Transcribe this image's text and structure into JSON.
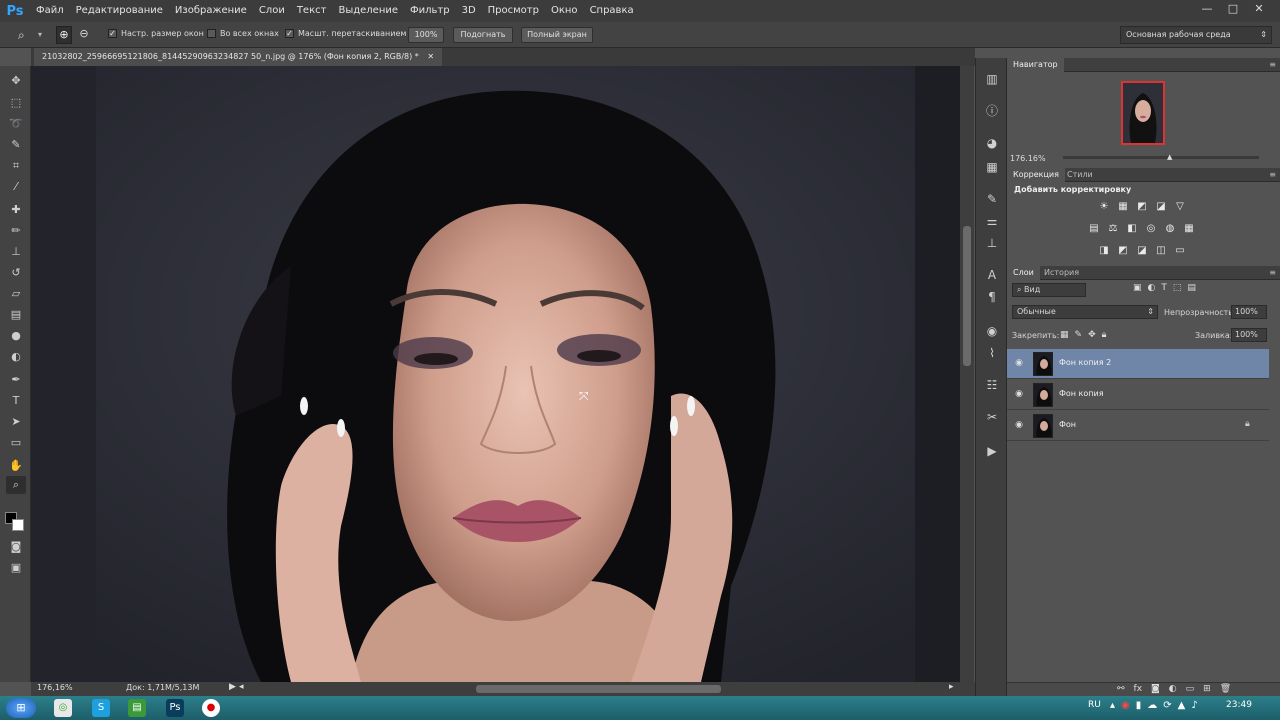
{
  "app": {
    "logo": "Ps"
  },
  "menu": [
    "Файл",
    "Редактирование",
    "Изображение",
    "Слои",
    "Текст",
    "Выделение",
    "Фильтр",
    "3D",
    "Просмотр",
    "Окно",
    "Справка"
  ],
  "window_controls": {
    "minimize": "—",
    "maximize": "□",
    "close": "✕"
  },
  "options": {
    "resize_windows": "Настр. размер окон",
    "all_windows": "Во всех окнах",
    "scrubby_zoom": "Масшт. перетаскиванием",
    "zoom_100": "100%",
    "fit_screen": "Подогнать",
    "full_screen": "Полный экран",
    "workspace": "Основная рабочая среда"
  },
  "document": {
    "tab_title": "21032802_25966695121806_81445290963234827 50_n.jpg @ 176% (Фон копия 2, RGB/8) *",
    "tab_close": "✕",
    "zoom": "176,16%",
    "doc_info": "Док: 1,71M/5,13M"
  },
  "navigator": {
    "title": "Навигатор",
    "zoom": "176.16%"
  },
  "adjustments": {
    "tabs": [
      "Коррекция",
      "Стили"
    ],
    "add_label": "Добавить корректировку",
    "row1": [
      "☀",
      "▦",
      "◩",
      "◪",
      "▽"
    ],
    "row2": [
      "▤",
      "⚖",
      "◧",
      "◎",
      "◍",
      "▦"
    ],
    "row3": [
      "◨",
      "◩",
      "◪",
      "◫",
      "▭"
    ]
  },
  "layers": {
    "tabs": [
      "Слои",
      "История"
    ],
    "filter": "Вид",
    "blend_mode": "Обычные",
    "opacity_label": "Непрозрачность:",
    "opacity": "100%",
    "lock_label": "Закрепить:",
    "fill_label": "Заливка:",
    "fill": "100%",
    "items": [
      {
        "name": "Фон копия 2",
        "selected": true
      },
      {
        "name": "Фон копия",
        "selected": false
      },
      {
        "name": "Фон",
        "selected": false
      }
    ]
  },
  "taskbar": {
    "lang": "RU",
    "time": "23:49"
  },
  "colors": {
    "selection": "#6f86a9",
    "canvas_bg": "#2d2e37",
    "taskbar": "#2c7f8a"
  }
}
